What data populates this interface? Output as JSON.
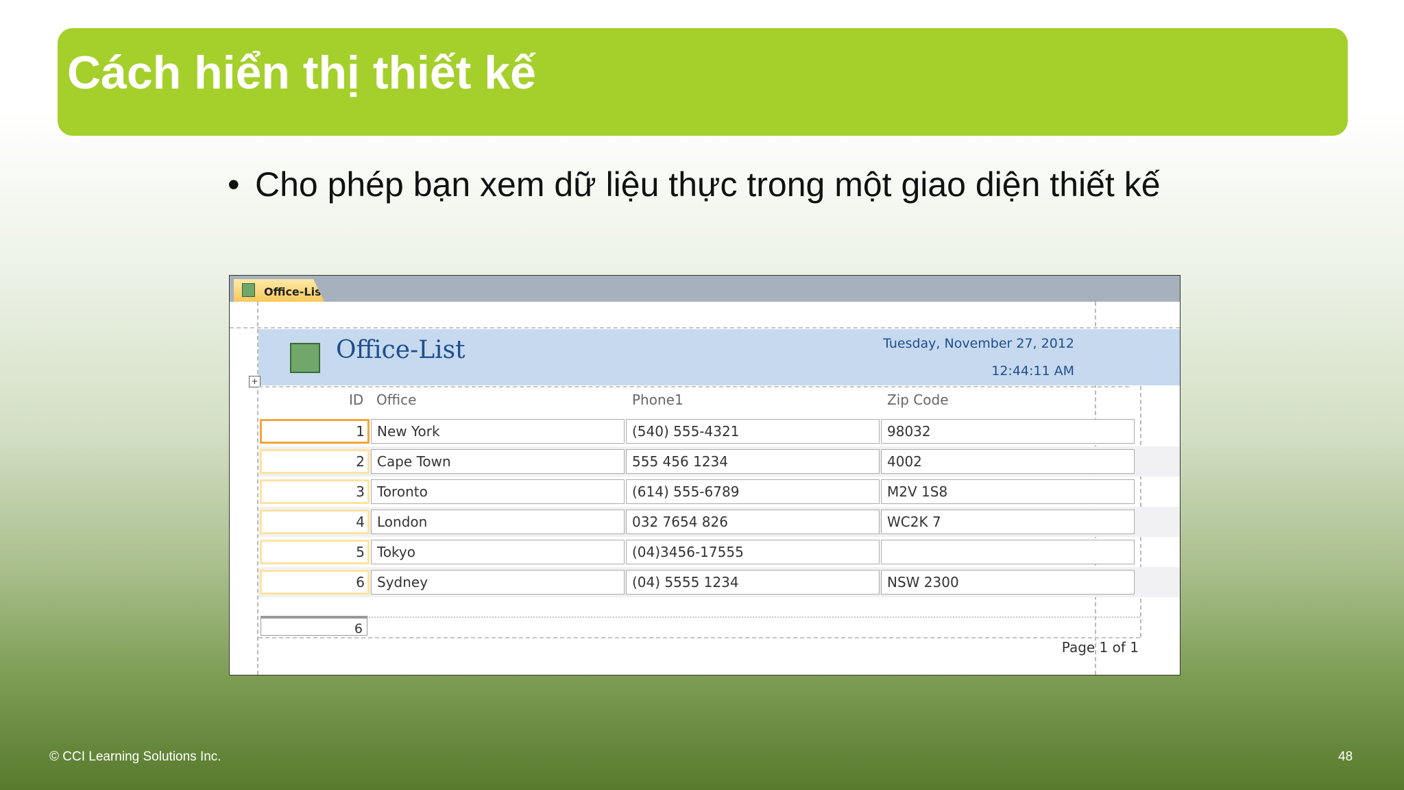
{
  "slide": {
    "title": "Cách hiển thị thiết kế",
    "bullet_symbol": "•",
    "bullet": "Cho phép bạn xem dữ liệu thực trong một giao diện thiết kế",
    "footer": "© CCI Learning Solutions Inc.",
    "page_number": "48"
  },
  "report": {
    "tab_label": "Office-List",
    "title": "Office-List",
    "date": "Tuesday, November 27, 2012",
    "time": "12:44:11 AM",
    "move_handle_icon": "move-handle-icon",
    "columns": [
      "ID",
      "Office",
      "Phone1",
      "Zip Code"
    ],
    "rows": [
      {
        "id": "1",
        "office": "New York",
        "phone": "(540) 555-4321",
        "zip": "98032"
      },
      {
        "id": "2",
        "office": "Cape Town",
        "phone": "555 456 1234",
        "zip": "4002"
      },
      {
        "id": "3",
        "office": "Toronto",
        "phone": "(614) 555-6789",
        "zip": "M2V 1S8"
      },
      {
        "id": "4",
        "office": "London",
        "phone": "032 7654 826",
        "zip": "WC2K 7"
      },
      {
        "id": "5",
        "office": "Tokyo",
        "phone": "(04)3456-17555",
        "zip": ""
      },
      {
        "id": "6",
        "office": "Sydney",
        "phone": "(04) 5555 1234",
        "zip": "NSW 2300"
      }
    ],
    "footer_count": "6",
    "page_text": "Page 1 of 1"
  },
  "colors": {
    "title_bar": "#a5d02b",
    "report_header": "#c6d9ef",
    "tab_active": "#f7c95b",
    "selected_border": "#f4a53a"
  }
}
